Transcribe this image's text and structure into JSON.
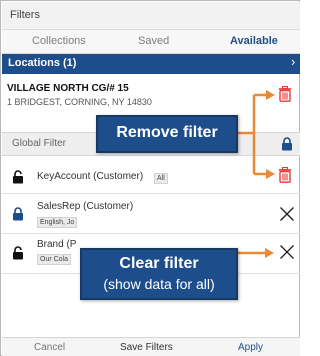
{
  "panel": {
    "title": "Filters"
  },
  "tabs": [
    {
      "label": "Collections"
    },
    {
      "label": "Saved"
    },
    {
      "label": "Available",
      "active": true
    }
  ],
  "locations": {
    "header": "Locations (1)",
    "chevron": "›",
    "item": {
      "name": "VILLAGE NORTH CG/# 15",
      "address": "1 BRIDGEST, CORNING, NY 14830"
    }
  },
  "global_filter": {
    "label": "Global Filter",
    "filters": [
      {
        "name": "KeyAccount (Customer)",
        "chip": "All",
        "lock": "unlocked"
      },
      {
        "name": "SalesRep (Customer)",
        "chip": "English, Jo",
        "lock": "locked"
      },
      {
        "name": "Brand (P",
        "chip": "Our Cola",
        "lock": "unlocked"
      }
    ]
  },
  "footer": {
    "cancel": "Cancel",
    "save": "Save Filters",
    "apply": "Apply"
  },
  "callouts": {
    "remove": "Remove filter",
    "clear_main": "Clear filter",
    "clear_sub": "(show data for all)"
  },
  "colors": {
    "accent": "#1e4d8c",
    "trash": "#e53935",
    "arrow": "#e8893a"
  },
  "icons": [
    "trash-icon",
    "lock-icon",
    "unlock-icon",
    "close-icon"
  ]
}
